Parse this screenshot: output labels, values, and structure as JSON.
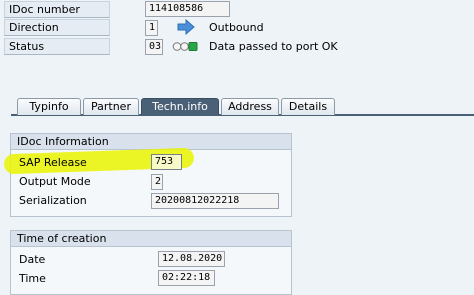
{
  "header": {
    "idoc_number_label": "IDoc number",
    "idoc_number_value": "114108586",
    "direction_label": "Direction",
    "direction_value": "1",
    "direction_text": "Outbound",
    "status_label": "Status",
    "status_value": "03",
    "status_text": "Data passed to port OK",
    "arrow_icon": "right-arrow-icon",
    "status_icon": "traffic-light-icon",
    "colors": {
      "arrow": "#4a8fd8",
      "status_green": "#28a745",
      "tab_active": "#4a6076",
      "highlight": "#e6f200"
    }
  },
  "tabs": [
    {
      "label": "Typinfo"
    },
    {
      "label": "Partner"
    },
    {
      "label": "Techn.info"
    },
    {
      "label": "Address"
    },
    {
      "label": "Details"
    }
  ],
  "active_tab": "Techn.info",
  "idoc_info": {
    "title": "IDoc Information",
    "sap_release_label": "SAP Release",
    "sap_release_value": "753",
    "output_mode_label": "Output Mode",
    "output_mode_value": "2",
    "serialization_label": "Serialization",
    "serialization_value": "20200812022218"
  },
  "time_of_creation": {
    "title": "Time of creation",
    "date_label": "Date",
    "date_value": "12.08.2020",
    "time_label": "Time",
    "time_value": "02:22:18"
  }
}
